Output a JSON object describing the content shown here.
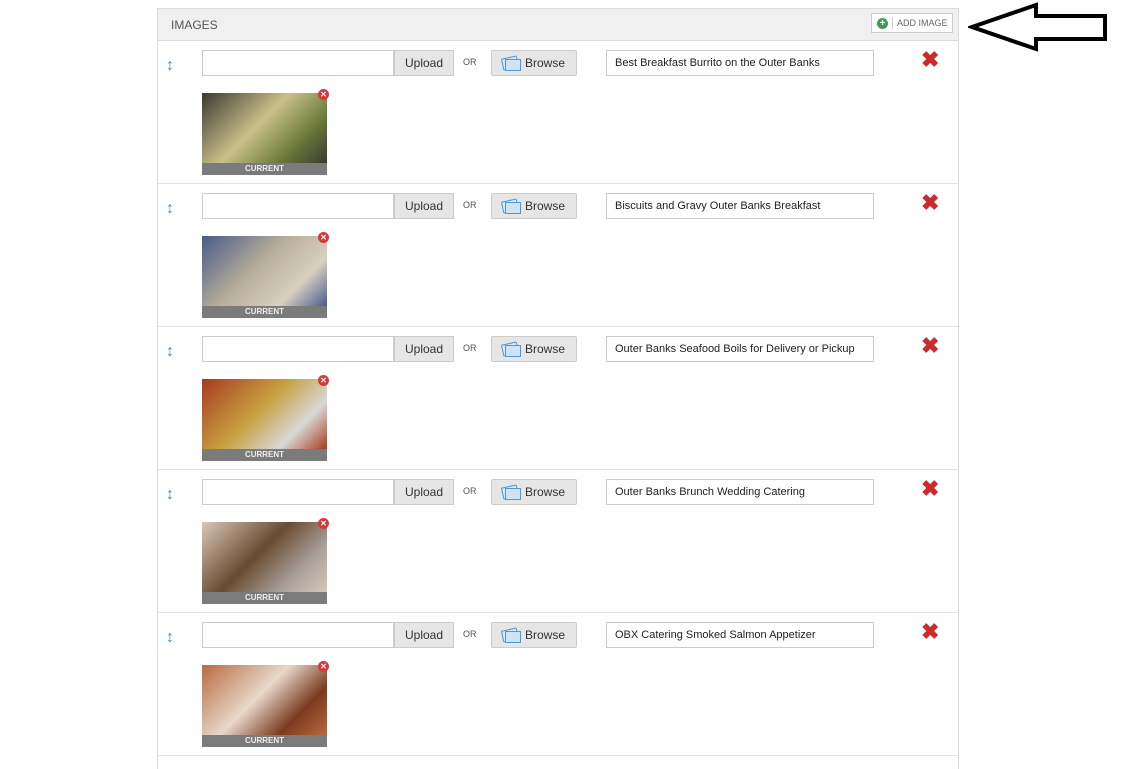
{
  "panel": {
    "title": "IMAGES",
    "add_button_label": "ADD IMAGE"
  },
  "labels": {
    "upload": "Upload",
    "or": "OR",
    "browse": "Browse",
    "current": "CURRENT"
  },
  "images": [
    {
      "title": "Best Breakfast Burrito on the Outer Banks",
      "file_value": "",
      "thumb_colors": [
        "#3a3a30",
        "#c9c08a",
        "#6b7a3a"
      ]
    },
    {
      "title": "Biscuits and Gravy Outer Banks Breakfast",
      "file_value": "",
      "thumb_colors": [
        "#4a5a8a",
        "#b8b09a",
        "#d8d0c0"
      ]
    },
    {
      "title": "Outer Banks Seafood Boils for Delivery or Pickup",
      "file_value": "",
      "thumb_colors": [
        "#a83a20",
        "#c8a040",
        "#d8d8d8"
      ]
    },
    {
      "title": "Outer Banks Brunch Wedding Catering",
      "file_value": "",
      "thumb_colors": [
        "#d8c8b8",
        "#6a4a30",
        "#a8a098"
      ]
    },
    {
      "title": "OBX Catering Smoked Salmon Appetizer",
      "file_value": "",
      "thumb_colors": [
        "#b86a40",
        "#e8d8c8",
        "#7a3a20"
      ]
    }
  ]
}
